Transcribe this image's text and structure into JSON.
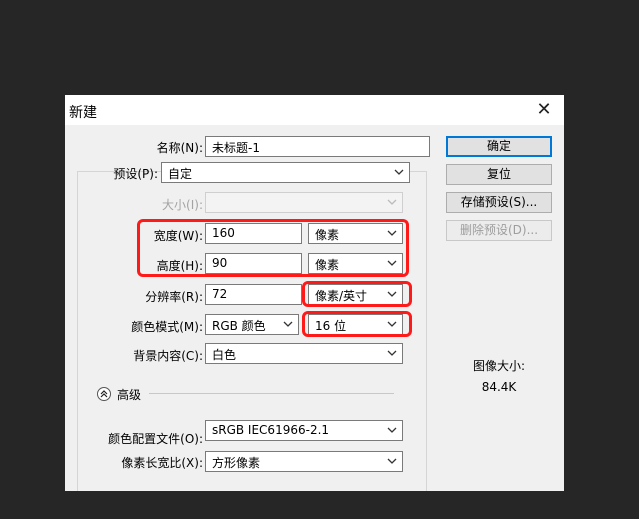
{
  "dialog": {
    "title": "新建",
    "close_glyph": "✕"
  },
  "form": {
    "name_label": "名称(N):",
    "name_value": "未标题-1",
    "preset_label": "预设(P):",
    "preset_value": "自定",
    "size_label": "大小(I):",
    "size_value": "",
    "width_label": "宽度(W):",
    "width_value": "160",
    "width_unit": "像素",
    "height_label": "高度(H):",
    "height_value": "90",
    "height_unit": "像素",
    "resolution_label": "分辨率(R):",
    "resolution_value": "72",
    "resolution_unit": "像素/英寸",
    "colormode_label": "颜色模式(M):",
    "colormode_value": "RGB 颜色",
    "bitdepth_value": "16 位",
    "background_label": "背景内容(C):",
    "background_value": "白色",
    "advanced_label": "高级",
    "profile_label": "颜色配置文件(O):",
    "profile_value": "sRGB IEC61966-2.1",
    "aspect_label": "像素长宽比(X):",
    "aspect_value": "方形像素"
  },
  "buttons": {
    "ok": "确定",
    "reset": "复位",
    "save_preset": "存储预设(S)...",
    "delete_preset": "删除预设(D)..."
  },
  "info": {
    "image_size_label": "图像大小:",
    "image_size_value": "84.4K"
  },
  "colors": {
    "highlight": "#ff1a1a",
    "background": "#262626",
    "dialog": "#f0f0f0",
    "primary_border": "#0078d7"
  },
  "icons": {
    "dropdown": "chevron-down-icon",
    "collapse": "double-chevron-up-icon",
    "close": "close-icon"
  }
}
